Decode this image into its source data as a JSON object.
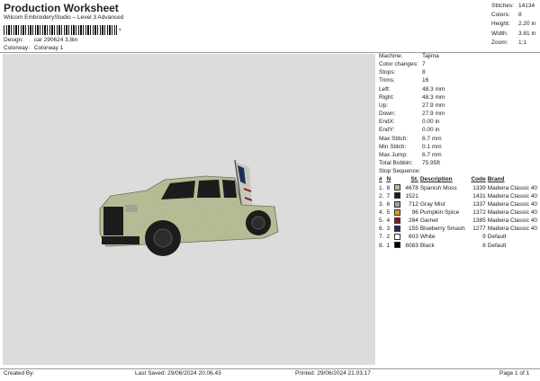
{
  "header": {
    "title": "Production Worksheet",
    "subtitle": "Wilcom EmbroideryStudio – Level 3 Advanced",
    "barcode_mark": ","
  },
  "meta": {
    "design_label": "Design:",
    "design_value": "car 290624 3,8in",
    "colorway_label": "Colorway:",
    "colorway_value": "Colorway 1"
  },
  "stats": [
    {
      "label": "Stitches:",
      "value": "14134"
    },
    {
      "label": "Colors:",
      "value": "8"
    },
    {
      "label": "Height:",
      "value": "2.20 in"
    },
    {
      "label": "Width:",
      "value": "3.81 in"
    },
    {
      "label": "Zoom:",
      "value": "1:1"
    }
  ],
  "machine_info": [
    {
      "label": "Machine:",
      "value": "Tajima"
    },
    {
      "label": "Color changes:",
      "value": "7"
    },
    {
      "label": "Stops:",
      "value": "8"
    },
    {
      "label": "Trims:",
      "value": "16"
    },
    {
      "label": "Left:",
      "value": "48.3 mm"
    },
    {
      "label": "Right:",
      "value": "48.3 mm"
    },
    {
      "label": "Up:",
      "value": "27.9 mm"
    },
    {
      "label": "Down:",
      "value": "27.9 mm"
    },
    {
      "label": "EndX:",
      "value": "0.00 in"
    },
    {
      "label": "EndY:",
      "value": "0.00 in"
    },
    {
      "label": "Max Stitch:",
      "value": "6.7 mm"
    },
    {
      "label": "Min Stitch:",
      "value": "0.1 mm"
    },
    {
      "label": "Max Jump:",
      "value": "6.7 mm"
    },
    {
      "label": "Total Bobbin:",
      "value": "75.95ft"
    }
  ],
  "stop_sequence": {
    "label": "Stop Sequence:",
    "headers": [
      "#",
      "N",
      "St.",
      "Description",
      "Code",
      "Brand"
    ],
    "rows": [
      {
        "num": "1.",
        "n": "8",
        "color": "#b9bd98",
        "st": "4678",
        "desc": "Spanish Moss",
        "code": "1339",
        "brand": "Madeira Classic 40"
      },
      {
        "num": "2.",
        "n": "7",
        "color": "#1c1c1c",
        "st": "1521",
        "desc": "",
        "code": "1431",
        "brand": "Madeira Classic 40"
      },
      {
        "num": "3.",
        "n": "6",
        "color": "#a2a394",
        "st": "712",
        "desc": "Gray Mist",
        "code": "1337",
        "brand": "Madeira Classic 40"
      },
      {
        "num": "4.",
        "n": "5",
        "color": "#d99a2b",
        "st": "96",
        "desc": "Pumpkin Spice",
        "code": "1372",
        "brand": "Madeira Classic 40"
      },
      {
        "num": "5.",
        "n": "4",
        "color": "#7a1f2b",
        "st": "284",
        "desc": "Garnet",
        "code": "1385",
        "brand": "Madeira Classic 40"
      },
      {
        "num": "6.",
        "n": "3",
        "color": "#1f2d5a",
        "st": "155",
        "desc": "Blueberry Smash",
        "code": "1277",
        "brand": "Madeira Classic 40"
      },
      {
        "num": "7.",
        "n": "2",
        "color": "#ffffff",
        "st": "603",
        "desc": "White",
        "code": "9",
        "brand": "Default"
      },
      {
        "num": "8.",
        "n": "1",
        "color": "#000000",
        "st": "6083",
        "desc": "Black",
        "code": "8",
        "brand": "Default"
      }
    ]
  },
  "footer": {
    "created_by": "Created By:",
    "last_saved": "Last Saved: 29/06/2024 20.06.43",
    "printed": "Printed: 29/06/2024 21.03.17",
    "page": "Page 1 of 1"
  },
  "colors": {
    "canvas_bg": "#dcdcdc",
    "truck_body": "#b9bd98",
    "truck_dark": "#1c1c1c",
    "flag_red": "#7a1f2b",
    "flag_blue": "#1f2d5a"
  }
}
